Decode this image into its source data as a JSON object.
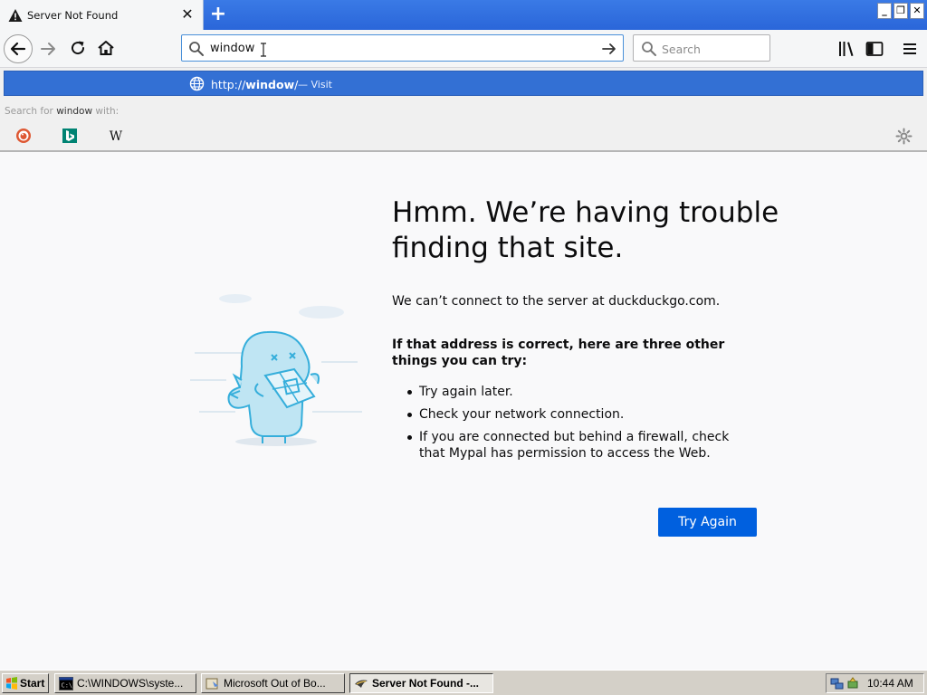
{
  "tab": {
    "title": "Server Not Found",
    "close_glyph": "✕"
  },
  "newtab": {
    "glyph": "+"
  },
  "window": {
    "minimize": "_",
    "restore": "❐",
    "close": "✕"
  },
  "urlbar": {
    "value": "window"
  },
  "searchbox": {
    "placeholder": "Search"
  },
  "dropdown": {
    "suggestion_prefix": "http://",
    "suggestion_host": "window",
    "suggestion_suffix": "/",
    "suggestion_action": "— Visit",
    "search_for_label": "Search for",
    "search_term": "window",
    "search_with_label": "with:",
    "engines": [
      "DuckDuckGo",
      "Bing",
      "Wikipedia"
    ]
  },
  "error": {
    "headline": "Hmm. We’re having trouble finding that site.",
    "description": "We can’t connect to the server at duckduckgo.com.",
    "subheading": "If that address is correct, here are three other things you can try:",
    "tips": [
      "Try again later.",
      "Check your network connection.",
      "If you are connected but behind a firewall, check that Mypal has permission to access the Web."
    ],
    "button": "Try Again"
  },
  "taskbar": {
    "start": "Start",
    "tasks": [
      {
        "label": "C:\\WINDOWS\\syste...",
        "active": false
      },
      {
        "label": "Microsoft Out of Bo...",
        "active": false
      },
      {
        "label": "Server Not Found -...",
        "active": true
      }
    ],
    "clock": "10:44 AM"
  },
  "colors": {
    "accent": "#0060df",
    "tab_strip": "#2a66d9",
    "suggest_highlight": "#3370d4"
  }
}
